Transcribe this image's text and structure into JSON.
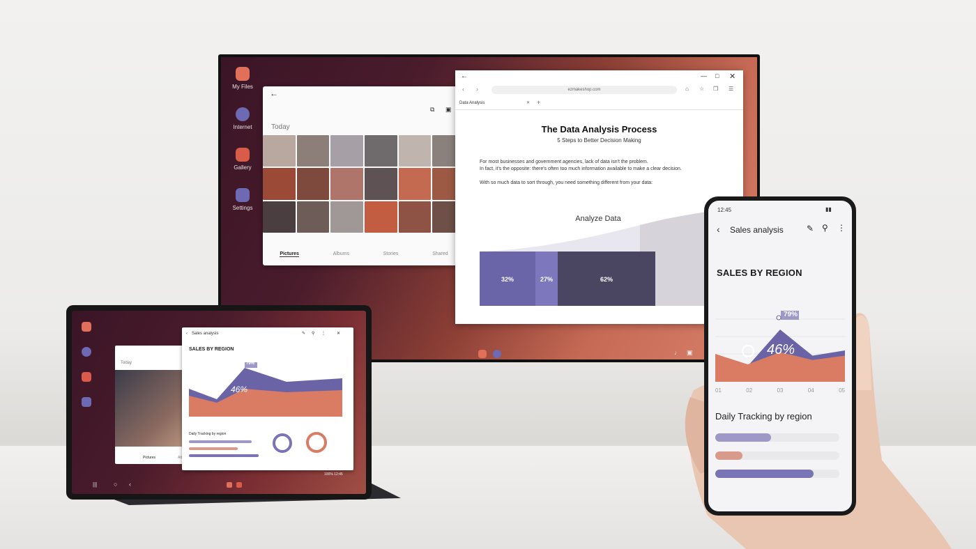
{
  "tv": {
    "dock": [
      {
        "label": "My Files",
        "icon": "folder-icon",
        "color": "#e0705a"
      },
      {
        "label": "Internet",
        "icon": "internet-icon",
        "color": "#6d6ab3"
      },
      {
        "label": "Gallery",
        "icon": "gallery-icon",
        "color": "#d95c4a"
      },
      {
        "label": "Settings",
        "icon": "gear-icon",
        "color": "#6d6ab3"
      }
    ],
    "gallery": {
      "today": "Today",
      "tabs": [
        "Pictures",
        "Albums",
        "Stories",
        "Shared"
      ],
      "selected_tab": "Pictures"
    },
    "browser": {
      "url": "ezmakeshop.com",
      "tab_label": "Data Analysis",
      "title": "The Data Analysis Process",
      "subtitle": "5 Steps to Better Decision Making",
      "para1_line1": "For most businesses and government agencies, lack of data isn't the problem.",
      "para1_line2": "In fact, it's the opposite: there's often too much information available to make a clear decision.",
      "para2": "With so much data to sort through, you need something different from your data:",
      "chart_title": "Analyze Data"
    }
  },
  "tablet": {
    "app_title": "Sales analysis",
    "heading": "SALES BY REGION",
    "gallery_today": "Today",
    "daily_label": "Daily Tracking by region",
    "chart_tags": [
      "79%",
      "46%"
    ],
    "status": "100%  12:45",
    "gallery_tabs": [
      "Pictures",
      "Albums"
    ]
  },
  "phone": {
    "time": "12:45",
    "app_title": "Sales analysis",
    "heading": "SALES BY REGION",
    "daily_label": "Daily Tracking by region",
    "tag_high": "79%",
    "tag_mid": "46%",
    "x_ticks": [
      "01",
      "02",
      "03",
      "04",
      "05"
    ],
    "bars": [
      {
        "fraction": 0.45,
        "color": "#9d98c5"
      },
      {
        "fraction": 0.22,
        "color": "#d89a8a"
      },
      {
        "fraction": 0.79,
        "color": "#7a73b5"
      }
    ]
  },
  "chart_data": [
    {
      "type": "bar",
      "title": "Analyze Data",
      "categories": [
        "",
        "",
        ""
      ],
      "values": [
        32,
        27,
        62
      ],
      "labels": [
        "32%",
        "27%",
        "62%"
      ],
      "colors": [
        "#6a65a8",
        "#7d78bd",
        "#4a4560"
      ]
    },
    {
      "type": "area",
      "title": "SALES BY REGION",
      "x": [
        "01",
        "02",
        "03",
        "04",
        "05"
      ],
      "series": [
        {
          "values": [
            28,
            18,
            60,
            30,
            36
          ],
          "color": "#6a64a7"
        },
        {
          "values": [
            32,
            20,
            34,
            25,
            30
          ],
          "color": "#d97c63"
        }
      ],
      "annotations": [
        "79%",
        "46%"
      ]
    }
  ]
}
